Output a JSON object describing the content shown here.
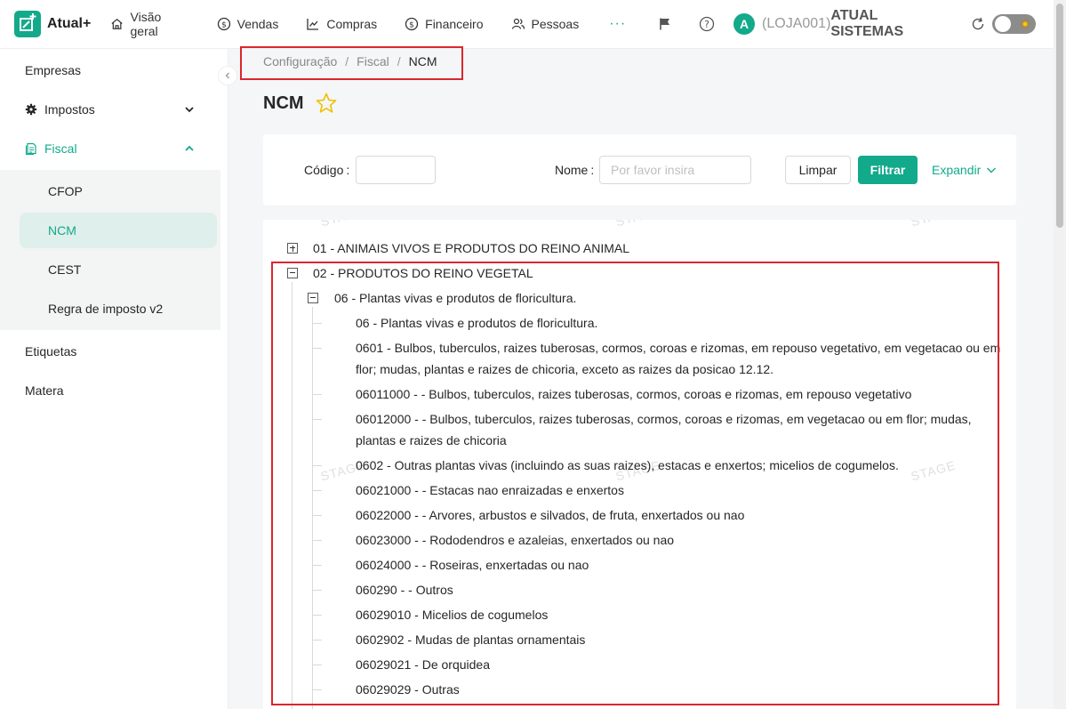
{
  "app": {
    "name": "Atual+"
  },
  "nav": {
    "items": [
      {
        "label": "Visão geral",
        "icon": "home-icon"
      },
      {
        "label": "Vendas",
        "icon": "dollar-circle-icon"
      },
      {
        "label": "Compras",
        "icon": "chart-line-icon"
      },
      {
        "label": "Financeiro",
        "icon": "dollar-circle-icon"
      },
      {
        "label": "Pessoas",
        "icon": "people-icon"
      }
    ],
    "more": "···"
  },
  "user": {
    "avatar_letter": "A",
    "store_code": "(LOJA001)",
    "store_name": "ATUAL SISTEMAS"
  },
  "sidebar": {
    "items": [
      {
        "label": "Empresas"
      },
      {
        "label": "Impostos"
      },
      {
        "label": "Fiscal"
      },
      {
        "label": "Etiquetas"
      },
      {
        "label": "Matera"
      }
    ],
    "fiscal_sub": [
      {
        "label": "CFOP"
      },
      {
        "label": "NCM"
      },
      {
        "label": "CEST"
      },
      {
        "label": "Regra de imposto v2"
      }
    ]
  },
  "breadcrumb": [
    "Configuração",
    "Fiscal",
    "NCM"
  ],
  "breadcrumb_sep": "/",
  "page": {
    "title": "NCM"
  },
  "filter": {
    "codigo_label": "Código",
    "nome_label": "Nome",
    "nome_placeholder": "Por favor insira",
    "limpar": "Limpar",
    "filtrar": "Filtrar",
    "expandir": "Expandir"
  },
  "watermark": "STAGE",
  "tree": {
    "n01": "01 - ANIMAIS VIVOS E PRODUTOS DO REINO ANIMAL",
    "n02": "02 - PRODUTOS DO REINO VEGETAL",
    "n06": "06 - Plantas vivas e produtos de floricultura.",
    "leaves": [
      "06 - Plantas vivas e produtos de floricultura.",
      "0601 - Bulbos, tuberculos, raizes tuberosas, cormos, coroas e rizomas, em repouso vegetativo, em vegetacao ou em",
      "flor; mudas, plantas e raizes de chicoria, exceto as raizes da posicao 12.12.",
      "06011000 - - Bulbos, tuberculos, raizes tuberosas, cormos, coroas e rizomas, em repouso vegetativo",
      "06012000 - - Bulbos, tuberculos, raizes tuberosas, cormos, coroas e rizomas, em vegetacao ou em flor; mudas,",
      "plantas e raizes de chicoria",
      "0602 - Outras plantas vivas (incluindo as suas raizes), estacas e enxertos; micelios de cogumelos.",
      "06021000 - - Estacas nao enraizadas e enxertos",
      "06022000 - - Arvores, arbustos e silvados, de fruta, enxertados ou nao",
      "06023000 - - Rododendros e azaleias, enxertados ou nao",
      "06024000 - - Roseiras, enxertadas ou nao",
      "060290 - - Outros",
      "06029010 - Micelios de cogumelos",
      "0602902 - Mudas de plantas ornamentais",
      "06029021 - De orquidea",
      "06029029 - Outras"
    ]
  }
}
